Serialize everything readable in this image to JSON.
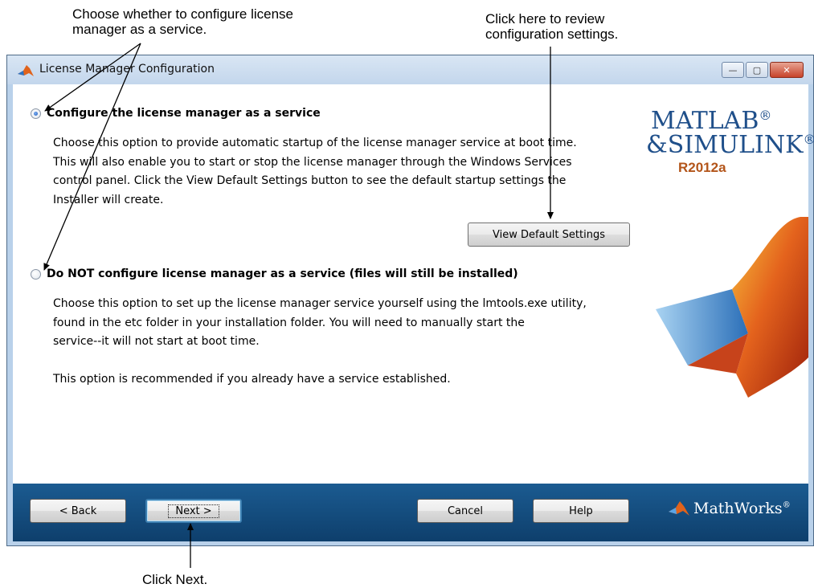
{
  "callouts": {
    "service_choice": "Choose whether to configure license\nmanager as a service.",
    "review_settings": "Click here to review\nconfiguration settings.",
    "click_next": "Click Next."
  },
  "window": {
    "title": "License Manager Configuration",
    "controls": {
      "minimize": "—",
      "maximize": "▢",
      "close": "✕"
    }
  },
  "options": [
    {
      "label": "Configure the license manager as a service",
      "checked": true,
      "description": "Choose this option to provide automatic startup of the license manager service at boot time.\nThis will also enable you to start or stop the license manager through the Windows Services\ncontrol panel. Click the View Default Settings button to see the default startup settings the\nInstaller will create."
    },
    {
      "label": "Do NOT configure license manager as a service (files will still be installed)",
      "checked": false,
      "description": "Choose this option to set up the license manager service yourself using the lmtools.exe utility,\nfound in the etc folder in your installation folder. You will need to manually start the\nservice--it will not start at boot time.\n\nThis option is recommended if you already have a service established."
    }
  ],
  "view_default_settings_label": "View Default Settings",
  "brand": {
    "matlab": "MATLAB",
    "simulink": "&SIMULINK",
    "mark": "®",
    "release": "R2012a"
  },
  "footer": {
    "back": "< Back",
    "next": "Next >",
    "cancel": "Cancel",
    "help": "Help",
    "company": "MathWorks"
  },
  "colors": {
    "footer_bg": "#164f82",
    "window_frame": "#b9d1ea",
    "brand_blue": "#1f4f8a",
    "release_orange": "#b3551a"
  }
}
